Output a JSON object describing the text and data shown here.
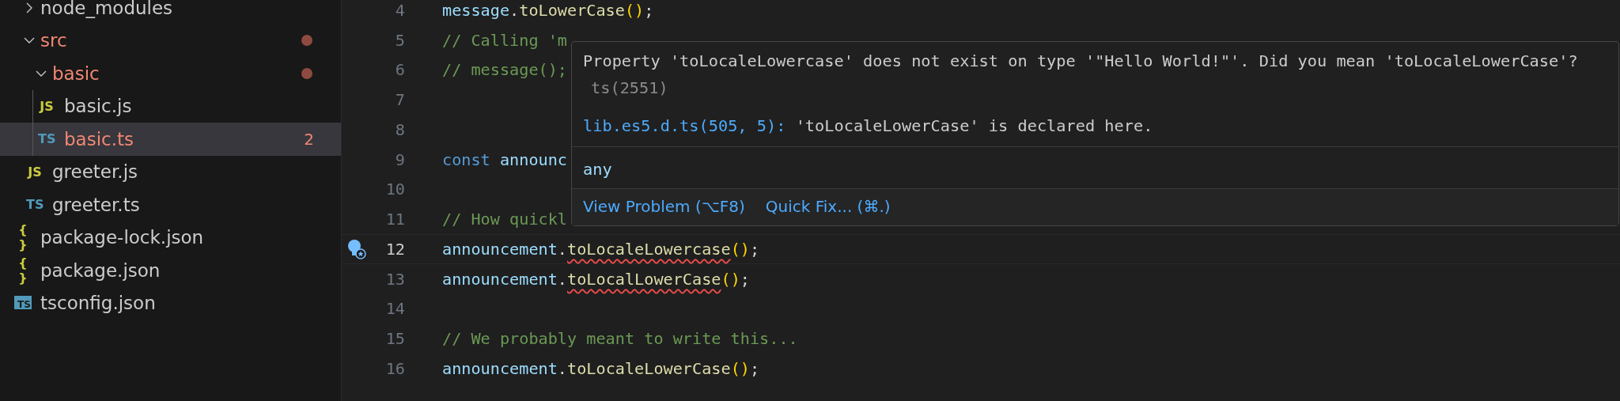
{
  "explorer": {
    "items": [
      {
        "kind": "folder",
        "label": "node_modules",
        "expanded": false,
        "error": false,
        "selected": false
      },
      {
        "kind": "folder",
        "label": "src",
        "expanded": true,
        "error": true,
        "selected": false,
        "modified": true,
        "children": [
          {
            "kind": "folder",
            "label": "basic",
            "expanded": true,
            "error": true,
            "selected": false,
            "modified": true,
            "children": [
              {
                "kind": "js",
                "icon": "JS",
                "label": "basic.js",
                "error": false,
                "selected": false
              },
              {
                "kind": "ts",
                "icon": "TS",
                "label": "basic.ts",
                "error": true,
                "selected": true,
                "badge": "2"
              }
            ]
          },
          {
            "kind": "js",
            "icon": "JS",
            "label": "greeter.js",
            "error": false,
            "selected": false
          },
          {
            "kind": "ts",
            "icon": "TS",
            "label": "greeter.ts",
            "error": false,
            "selected": false
          }
        ]
      },
      {
        "kind": "json",
        "icon": "{ }",
        "label": "package-lock.json",
        "error": false,
        "selected": false
      },
      {
        "kind": "json",
        "icon": "{ }",
        "label": "package.json",
        "error": false,
        "selected": false
      },
      {
        "kind": "tsconfig",
        "icon": "TS",
        "label": "tsconfig.json",
        "error": false,
        "selected": false
      }
    ]
  },
  "editor": {
    "lines": [
      {
        "number": "4",
        "current": false,
        "tokens": [
          {
            "kind": "variable",
            "text": "message"
          },
          {
            "kind": "plain",
            "text": "."
          },
          {
            "kind": "function",
            "text": "toLowerCase"
          },
          {
            "kind": "paren",
            "text": "()"
          },
          {
            "kind": "plain",
            "text": ";"
          }
        ]
      },
      {
        "number": "5",
        "current": false,
        "tokens": [
          {
            "kind": "comment",
            "text": "// Calling 'm"
          }
        ]
      },
      {
        "number": "6",
        "current": false,
        "tokens": [
          {
            "kind": "comment",
            "text": "// message();"
          }
        ]
      },
      {
        "number": "7",
        "current": false
      },
      {
        "number": "8",
        "current": false
      },
      {
        "number": "9",
        "current": false,
        "tokens": [
          {
            "kind": "keyword",
            "text": "const "
          },
          {
            "kind": "variable",
            "text": "announc"
          }
        ]
      },
      {
        "number": "10",
        "current": false
      },
      {
        "number": "11",
        "current": false,
        "tokens": [
          {
            "kind": "comment",
            "text": "// How quickl"
          }
        ]
      },
      {
        "number": "12",
        "current": true,
        "lightbulb": true,
        "tokens": [
          {
            "kind": "variable",
            "text": "announcement"
          },
          {
            "kind": "plain",
            "text": "."
          },
          {
            "kind": "function",
            "text": "toLocaleLowercase",
            "error": true
          },
          {
            "kind": "paren",
            "text": "()"
          },
          {
            "kind": "plain",
            "text": ";"
          }
        ]
      },
      {
        "number": "13",
        "current": false,
        "tokens": [
          {
            "kind": "variable",
            "text": "announcement"
          },
          {
            "kind": "plain",
            "text": "."
          },
          {
            "kind": "function",
            "text": "toLocalLowerCase",
            "error": true
          },
          {
            "kind": "paren",
            "text": "()"
          },
          {
            "kind": "plain",
            "text": ";"
          }
        ]
      },
      {
        "number": "14",
        "current": false
      },
      {
        "number": "15",
        "current": false,
        "tokens": [
          {
            "kind": "comment",
            "text": "// We probably meant to write this..."
          }
        ]
      },
      {
        "number": "16",
        "current": false,
        "tokens": [
          {
            "kind": "variable",
            "text": "announcement"
          },
          {
            "kind": "plain",
            "text": "."
          },
          {
            "kind": "function",
            "text": "toLocaleLowerCase"
          },
          {
            "kind": "paren",
            "text": "()"
          },
          {
            "kind": "plain",
            "text": ";"
          }
        ]
      }
    ]
  },
  "hover": {
    "message": "Property 'toLocaleLowercase' does not exist on type '\"Hello World!\"'. Did you mean 'toLocaleLowerCase'?",
    "code": "ts(2551)",
    "related_link": "lib.es5.d.ts(505, 5):",
    "related_text": "'toLocaleLowerCase' is declared here.",
    "type": "any",
    "actions": [
      "View Problem (⌥F8)",
      "Quick Fix... (⌘.)"
    ]
  }
}
